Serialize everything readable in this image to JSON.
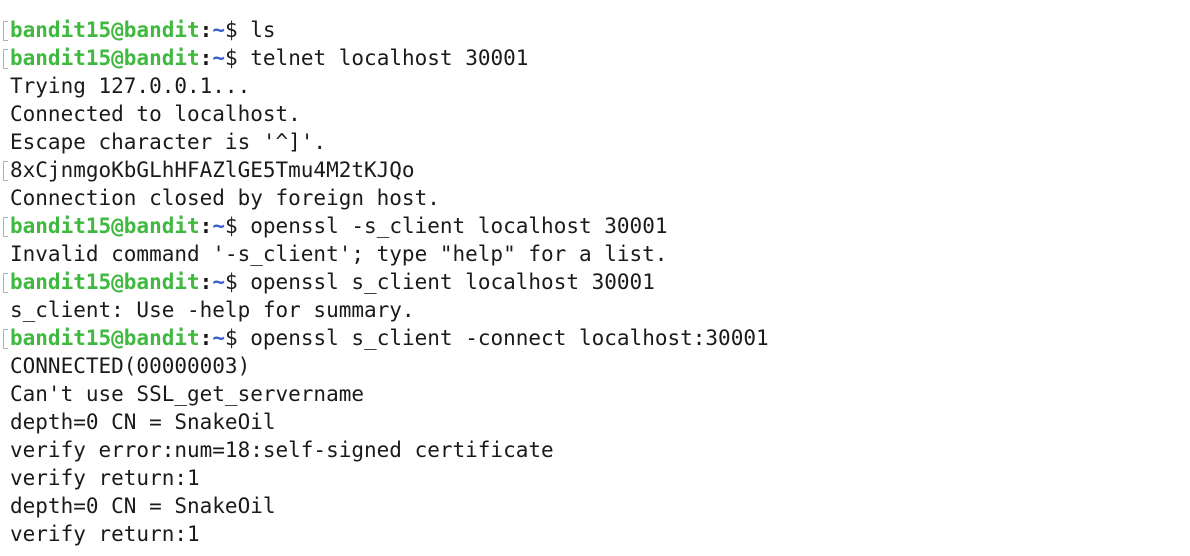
{
  "colors": {
    "prompt_user": "#3fb93f",
    "prompt_path": "#3a5fcc",
    "text": "#1a1a1a",
    "background": "#ffffff"
  },
  "lines": [
    {
      "kind": "prompt",
      "mark": true,
      "user": "bandit15@bandit",
      "path": "~",
      "symbol": "$",
      "command": " ls"
    },
    {
      "kind": "prompt",
      "mark": true,
      "user": "bandit15@bandit",
      "path": "~",
      "symbol": "$",
      "command": " telnet localhost 30001"
    },
    {
      "kind": "output",
      "mark": false,
      "text": "Trying 127.0.0.1..."
    },
    {
      "kind": "output",
      "mark": false,
      "text": "Connected to localhost."
    },
    {
      "kind": "output",
      "mark": false,
      "text": "Escape character is '^]'."
    },
    {
      "kind": "output",
      "mark": true,
      "text": "8xCjnmgoKbGLhHFAZlGE5Tmu4M2tKJQo"
    },
    {
      "kind": "output",
      "mark": false,
      "text": "Connection closed by foreign host."
    },
    {
      "kind": "prompt",
      "mark": true,
      "user": "bandit15@bandit",
      "path": "~",
      "symbol": "$",
      "command": " openssl -s_client localhost 30001"
    },
    {
      "kind": "output",
      "mark": false,
      "text": "Invalid command '-s_client'; type \"help\" for a list."
    },
    {
      "kind": "prompt",
      "mark": true,
      "user": "bandit15@bandit",
      "path": "~",
      "symbol": "$",
      "command": " openssl s_client localhost 30001"
    },
    {
      "kind": "output",
      "mark": false,
      "text": "s_client: Use -help for summary."
    },
    {
      "kind": "prompt",
      "mark": true,
      "user": "bandit15@bandit",
      "path": "~",
      "symbol": "$",
      "command": " openssl s_client -connect localhost:30001"
    },
    {
      "kind": "output",
      "mark": false,
      "text": "CONNECTED(00000003)"
    },
    {
      "kind": "output",
      "mark": false,
      "text": "Can't use SSL_get_servername"
    },
    {
      "kind": "output",
      "mark": false,
      "text": "depth=0 CN = SnakeOil"
    },
    {
      "kind": "output",
      "mark": false,
      "text": "verify error:num=18:self-signed certificate"
    },
    {
      "kind": "output",
      "mark": false,
      "text": "verify return:1"
    },
    {
      "kind": "output",
      "mark": false,
      "text": "depth=0 CN = SnakeOil"
    },
    {
      "kind": "output",
      "mark": false,
      "text": "verify return:1"
    }
  ]
}
